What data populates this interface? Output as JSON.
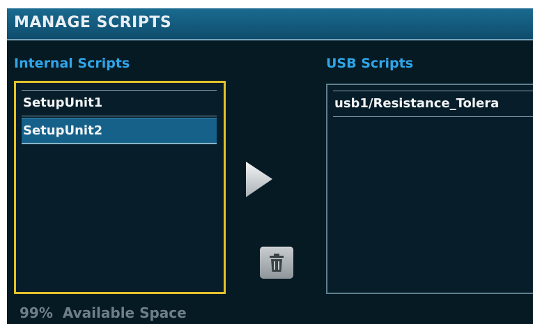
{
  "header": {
    "title": "MANAGE SCRIPTS"
  },
  "internal": {
    "label": "Internal Scripts",
    "items": [
      {
        "label": "SetupUnit1",
        "selected": false
      },
      {
        "label": "SetupUnit2",
        "selected": true
      }
    ]
  },
  "usb": {
    "label": "USB Scripts",
    "items": [
      {
        "label": "usb1/Resistance_Tolera"
      }
    ]
  },
  "actions": {
    "copy_icon": "play-arrow-icon",
    "delete_icon": "trash-icon"
  },
  "footer": {
    "percent": "99%",
    "label": "Available Space"
  },
  "colors": {
    "background": "#061a24",
    "title_bar": "#1a6a90",
    "section_label": "#2fa6e8",
    "focus_border": "#e2c22a",
    "selected_row": "#15618a"
  }
}
